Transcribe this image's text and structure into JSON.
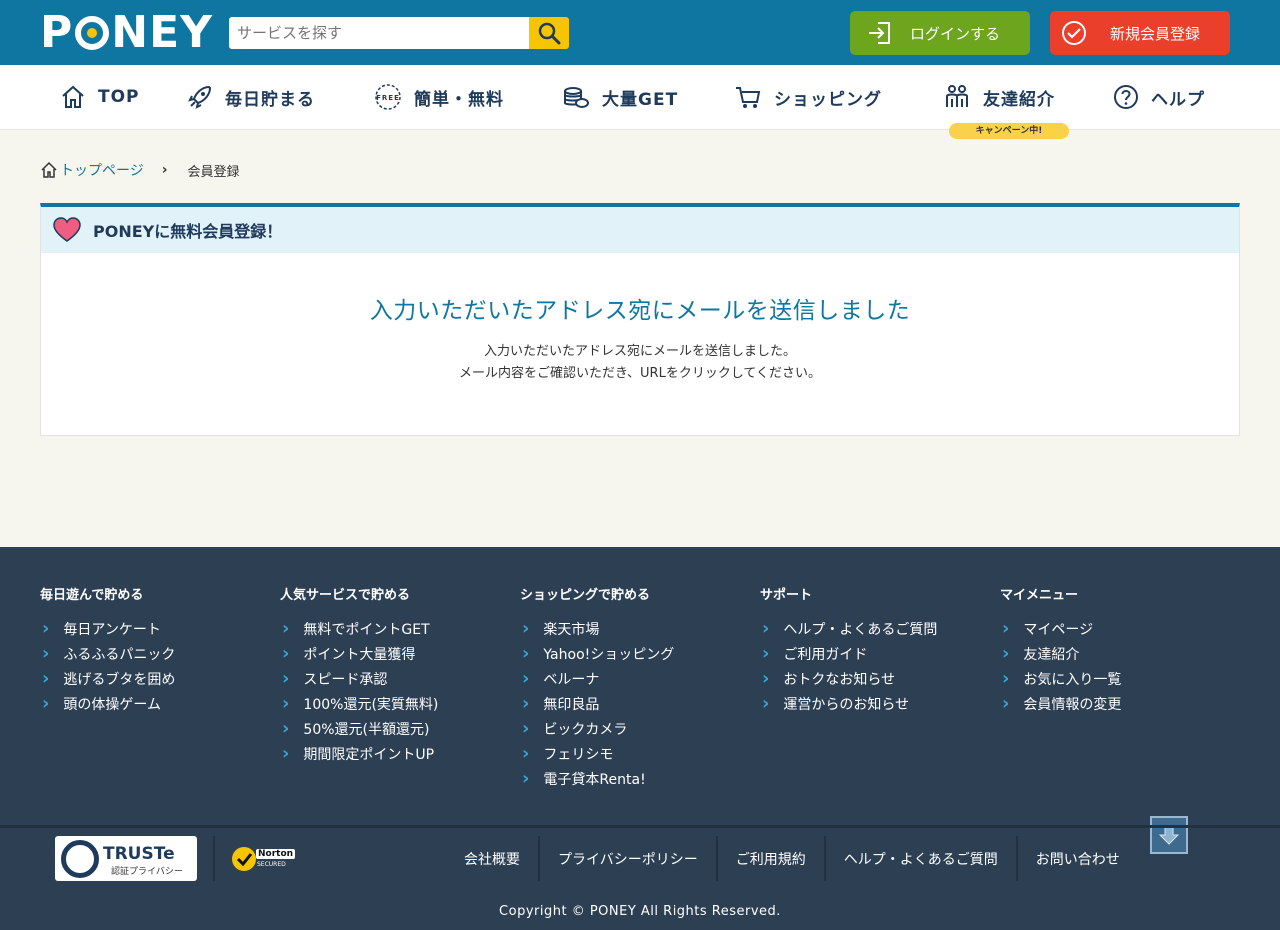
{
  "header": {
    "logo_text": "PONEY",
    "search_placeholder": "サービスを探す",
    "login_label": "ログインする",
    "signup_label": "新規会員登録"
  },
  "nav": {
    "items": [
      {
        "label": "TOP",
        "icon": "home-icon"
      },
      {
        "label": "毎日貯まる",
        "icon": "rocket-icon"
      },
      {
        "label": "簡単・無料",
        "icon": "free-icon"
      },
      {
        "label": "大量GET",
        "icon": "coins-icon"
      },
      {
        "label": "ショッピング",
        "icon": "cart-icon"
      },
      {
        "label": "友達紹介",
        "icon": "friends-icon"
      },
      {
        "label": "ヘルプ",
        "icon": "help-icon"
      }
    ],
    "campaign_badge": "キャンペーン中!"
  },
  "breadcrumb": {
    "home": "トップページ",
    "current": "会員登録"
  },
  "panel": {
    "heading": "PONEYに無料会員登録！",
    "title": "入力いただいたアドレス宛にメールを送信しました",
    "text_line1": "入力いただいたアドレス宛にメールを送信しました。",
    "text_line2": "メール内容をご確認いただき、URLをクリックしてください。"
  },
  "footer": {
    "columns": [
      {
        "title": "毎日遊んで貯める",
        "items": [
          "毎日アンケート",
          "ふるふるパニック",
          "逃げるブタを囲め",
          "頭の体操ゲーム"
        ]
      },
      {
        "title": "人気サービスで貯める",
        "items": [
          "無料でポイントGET",
          "ポイント大量獲得",
          "スピード承認",
          "100%還元(実質無料)",
          "50%還元(半額還元)",
          "期間限定ポイントUP"
        ]
      },
      {
        "title": "ショッピングで貯める",
        "items": [
          "楽天市場",
          "Yahoo!ショッピング",
          "ベルーナ",
          "無印良品",
          "ビックカメラ",
          "フェリシモ",
          "電子貸本Renta!"
        ]
      },
      {
        "title": "サポート",
        "items": [
          "ヘルプ・よくあるご質問",
          "ご利用ガイド",
          "おトクなお知らせ",
          "運営からのお知らせ"
        ]
      },
      {
        "title": "マイメニュー",
        "items": [
          "マイページ",
          "友達紹介",
          "お気に入り一覧",
          "会員情報の変更"
        ]
      }
    ],
    "links": [
      "会社概要",
      "プライバシーポリシー",
      "ご利用規約",
      "ヘルプ・よくあるご質問",
      "お問い合わせ"
    ],
    "truste_name": "TRUSTe",
    "truste_sub": "認証プライバシー",
    "norton_label": "Norton",
    "norton_sub": "SECURED",
    "copyright": "Copyright © PONEY All Rights Reserved."
  },
  "colors": {
    "brand_blue": "#0e76a0",
    "login_green": "#6ea51e",
    "signup_red": "#ea3f2a",
    "accent_yellow": "#f6c400",
    "footer_bg": "#2c3f53"
  }
}
